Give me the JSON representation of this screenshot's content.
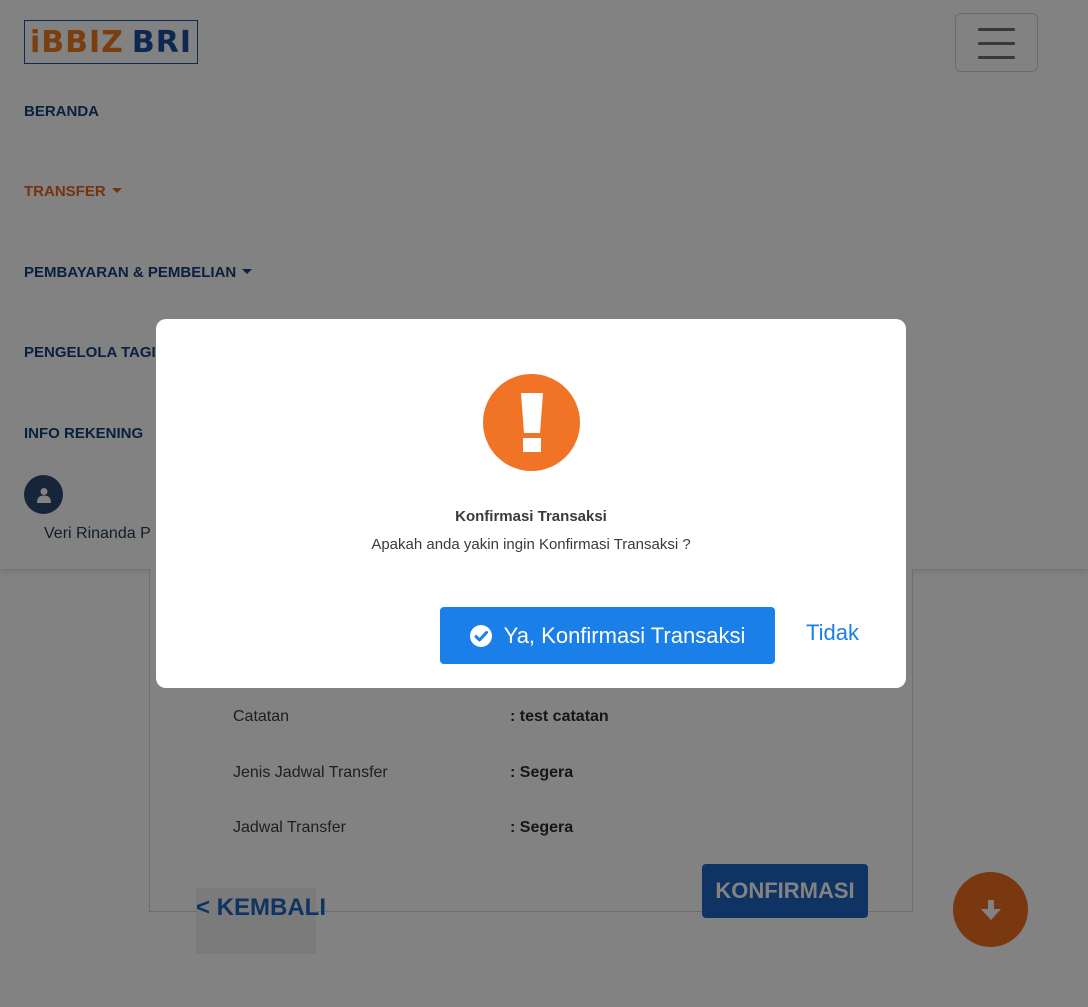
{
  "header": {
    "logo_left": "iBBIZ",
    "logo_right": "BRI",
    "menu_icon": "hamburger-icon"
  },
  "nav": {
    "items": [
      {
        "label": "BERANDA"
      },
      {
        "label": "TRANSFER"
      },
      {
        "label": "PEMBAYARAN & PEMBELIAN"
      },
      {
        "label": "PENGELOLA TAGI"
      },
      {
        "label": "INFO REKENING"
      }
    ],
    "user": {
      "name": "Veri Rinanda P",
      "icon": "user-icon"
    }
  },
  "details": [
    {
      "label": "Catatan",
      "value": ": test catatan"
    },
    {
      "label": "Jenis Jadwal Transfer",
      "value": ": Segera"
    },
    {
      "label": "Jadwal Transfer",
      "value": ": Segera"
    }
  ],
  "actions": {
    "confirm_label": "KONFIRMASI",
    "back_label": "< KEMBALI",
    "scroll_icon": "arrow-down-icon"
  },
  "modal": {
    "icon": "exclamation-icon",
    "title": "Konfirmasi Transaksi",
    "message": "Apakah anda yakin ingin Konfirmasi Transaksi ?",
    "yes_label": "Ya, Konfirmasi Transaksi",
    "no_label": "Tidak"
  },
  "colors": {
    "brand_blue": "#1e4fa0",
    "accent_orange": "#f07326",
    "primary_button": "#1a7fe8"
  }
}
